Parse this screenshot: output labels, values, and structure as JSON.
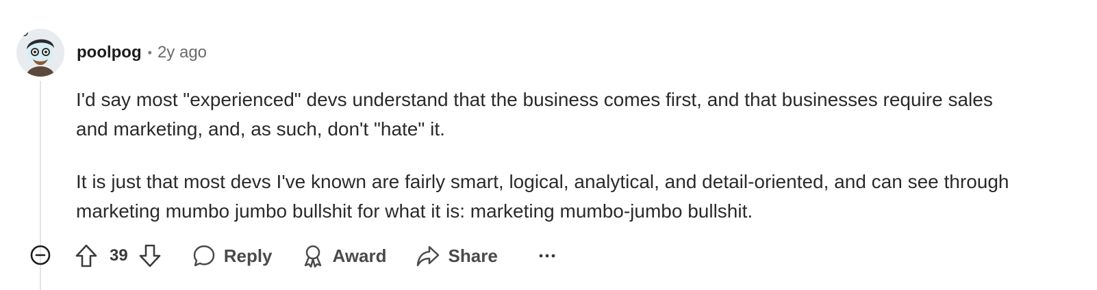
{
  "comment": {
    "author": "poolpog",
    "separator": "•",
    "timestamp": "2y ago",
    "paragraphs": [
      "I'd say most \"experienced\" devs understand that the business comes first, and that businesses require sales and marketing, and, as such, don't \"hate\" it.",
      "It is just that most devs I've known are fairly smart, logical, analytical, and detail-oriented, and can see through marketing mumbo jumbo bullshit for what it is: marketing mumbo-jumbo bullshit."
    ],
    "score": "39",
    "actions": {
      "reply_label": "Reply",
      "award_label": "Award",
      "share_label": "Share",
      "more_label": "···"
    },
    "icons": {
      "avatar": "avatar",
      "collapse": "collapse-minus-icon",
      "upvote": "arrow-up-icon",
      "downvote": "arrow-down-icon",
      "reply": "speech-bubble-icon",
      "award": "award-ribbon-icon",
      "share": "share-arrow-icon",
      "more": "ellipsis-icon"
    },
    "colors": {
      "icon": "#1c1c1c",
      "muted": "#6a6a6a",
      "thread_line": "#e2e4e6"
    }
  }
}
